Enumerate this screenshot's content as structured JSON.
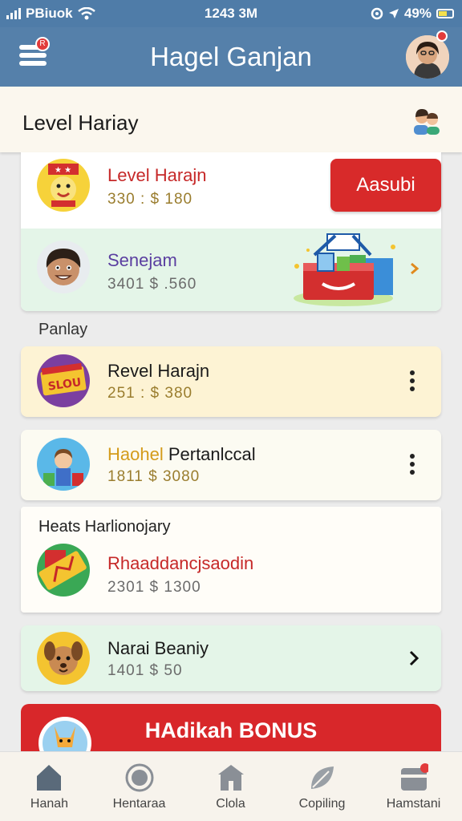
{
  "status_bar": {
    "carrier": "PBiuok",
    "time": "1243 3M",
    "battery": "49%"
  },
  "app_bar": {
    "title": "Hagel Ganjan",
    "menu_badge": "R"
  },
  "sub_header": {
    "title": "Level Hariay"
  },
  "top_card": {
    "title": "Level Harajn",
    "value": "330 : $ 180",
    "button_label": "Aasubi"
  },
  "featured_card": {
    "title": "Senejam",
    "value": "3401 $ .560"
  },
  "section_1": {
    "label": "Panlay",
    "items": [
      {
        "title": "Revel Harajn",
        "value": "251 : $ 380",
        "icon_text": "SLOU"
      },
      {
        "title_a": "Haohel",
        "title_b": " Pertanlccal",
        "value": "1811 $ 3080"
      }
    ]
  },
  "section_2": {
    "label": "Heats Harlionojary",
    "items": [
      {
        "title": "Rhaaddancjsaodin",
        "value": "2301 $ 1300"
      },
      {
        "title": "Narai Beaniy",
        "value": "1401 $ 50"
      }
    ]
  },
  "bonus": {
    "label": "HAdikah BONUS"
  },
  "tabs": [
    {
      "label": "Hanah",
      "icon": "home-icon"
    },
    {
      "label": "Hentaraa",
      "icon": "circle-icon"
    },
    {
      "label": "Clola",
      "icon": "store-icon"
    },
    {
      "label": "Copiling",
      "icon": "leaf-icon"
    },
    {
      "label": "Hamstani",
      "icon": "wallet-icon"
    }
  ],
  "colors": {
    "header_blue": "#5580aa",
    "accent_red": "#d82a2a",
    "mint": "#e4f5e8",
    "cream": "#fdf3d4"
  }
}
